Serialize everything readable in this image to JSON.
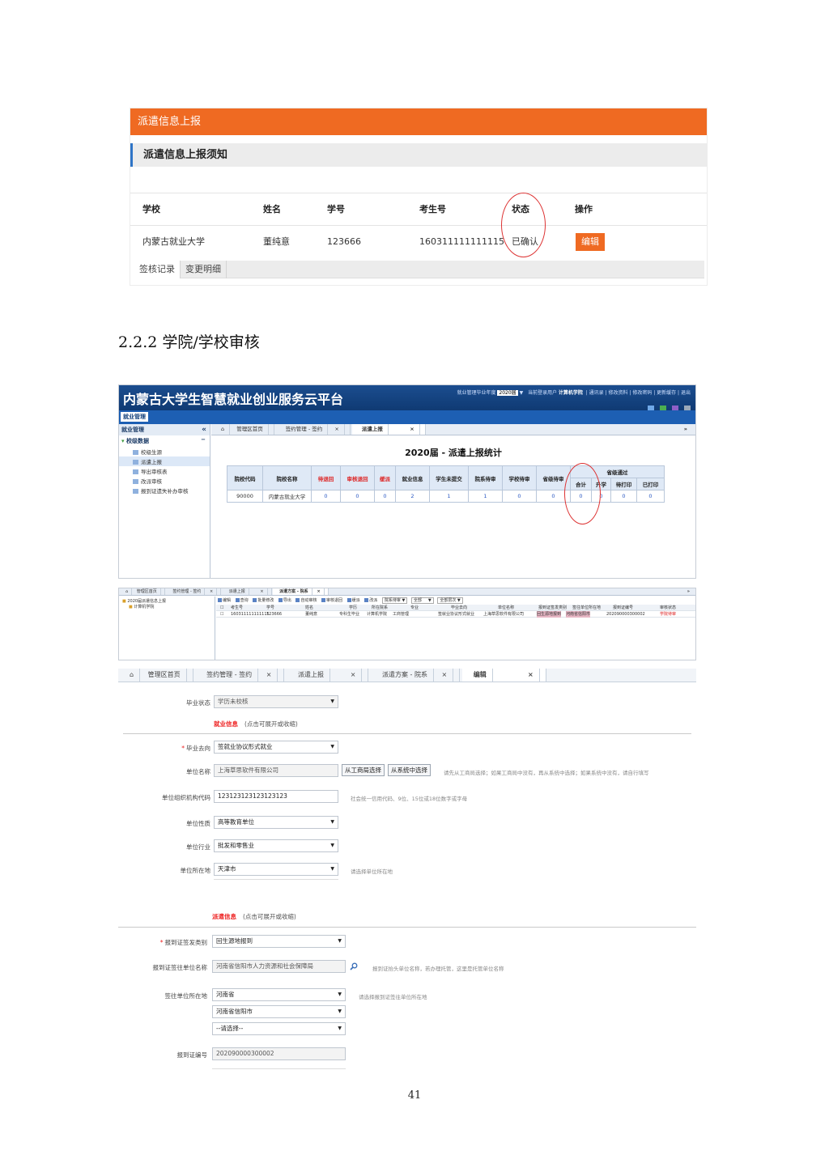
{
  "panel1": {
    "header_title": "派遣信息上报",
    "notice_title": "派遣信息上报须知",
    "columns": [
      "学校",
      "姓名",
      "学号",
      "考生号",
      "状态",
      "操作"
    ],
    "row": {
      "school": "内蒙古就业大学",
      "name": "董纯意",
      "student_id": "123666",
      "exam_id": "160311111111115",
      "status": "已确认",
      "action": "编辑"
    },
    "tabs": [
      "签核记录",
      "变更明细"
    ],
    "accent": "#ef6a22"
  },
  "section_heading": "2.2.2 学院/学校审核",
  "panel2": {
    "platform_title": "内蒙古大学生智慧就业创业服务云平台",
    "top_info_prefix": "就业管理毕业年度",
    "year": "2020届",
    "top_info_user_label": "当前登录用户",
    "top_info_user": "计算机学院",
    "top_links": "通讯录 | 修改资料 | 修改密码 | 更新缓存 | 退出",
    "menu": "就业管理",
    "sidebar_title": "就业管理",
    "sidebar_group": "校级数据",
    "sidebar_items": [
      "校级生源",
      "派遣上报",
      "导出审核表",
      "改派审核",
      "报到证遗失补办审核"
    ],
    "tabs": [
      "管理区首页",
      "签约管理 - 签约",
      "派遣上报"
    ],
    "stat_title": "2020届 - 派遣上报统计",
    "stat_headers": [
      "院校代码",
      "院校名称",
      "待退回",
      "审核退回",
      "缓派",
      "就业信息",
      "学生未提交",
      "院系待审",
      "学校待审",
      "省级待审"
    ],
    "stat_group": "省级通过",
    "stat_subheaders": [
      "合计",
      "升学",
      "待打印",
      "已打印"
    ],
    "stat_row": [
      "90000",
      "内蒙古就业大学",
      "0",
      "0",
      "0",
      "2",
      "1",
      "1",
      "0",
      "0",
      "0",
      "0",
      "0",
      "0"
    ]
  },
  "panel3": {
    "tabs": [
      "管理区首页",
      "签约管理 - 签约",
      "派遣上报",
      "派遣方案 - 院系"
    ],
    "tree_root": "2020届派遣信息上报",
    "tree_child": "计算机学院",
    "toolbar": [
      "编辑",
      "查询",
      "批量修改",
      "导出",
      "自动审核",
      "审核退回",
      "缓派",
      "改派"
    ],
    "filter1": "院系待审",
    "filter2": "全部",
    "filter3": "全部层次",
    "headers": [
      "考生号",
      "学号",
      "姓名",
      "学历",
      "所在院系",
      "专业",
      "毕业去向",
      "单位名称",
      "报到证签发类别",
      "签往单位所在地",
      "报到证编号",
      "审核状态"
    ],
    "row": [
      "160311111111115",
      "123666",
      "董纯意",
      "专科生毕业",
      "计算机学院",
      "工商管理",
      "签就业协议形式就业",
      "上海草思软件有限公司",
      "回生源地报到",
      "河南省信阳市",
      "202090000300002",
      "学院待审"
    ]
  },
  "panel4": {
    "tabs": [
      "管理区首页",
      "签约管理 - 签约",
      "派遣上报",
      "派遣方案 - 院系",
      "编辑"
    ],
    "graduation_status_label": "毕业状态",
    "graduation_status_value": "学历未校核",
    "section1_title": "就业信息",
    "section1_hint": "(点击可展开或收缩)",
    "destination_label": "毕业去向",
    "destination_value": "签就业协议形式就业",
    "unit_name_label": "单位名称",
    "unit_name_value": "上海草思软件有限公司",
    "btn_business": "从工商局选择",
    "btn_system": "从系统中选择",
    "unit_name_hint": "请先从工商局选择；如果工商局中没有，再从系统中选择；如果系统中没有，请自行填写",
    "org_code_label": "单位组织机构代码",
    "org_code_value": "123123123123123123",
    "org_code_hint": "社会统一信用代码、9位、15位或18位数字或字母",
    "unit_nature_label": "单位性质",
    "unit_nature_value": "高等教育单位",
    "industry_label": "单位行业",
    "industry_value": "批发和零售业",
    "location_label": "单位所在地",
    "location_value": "天津市",
    "location_hint": "请选择单位所在地",
    "section2_title": "派遣信息",
    "section2_hint": "(点击可展开或收缩)",
    "cert_type_label": "报到证签发类别",
    "cert_type_value": "回生源地报到",
    "cert_unit_label": "报到证签往单位名称",
    "cert_unit_value": "河南省信阳市人力资源和社会保障局",
    "cert_unit_hint": "报到证抬头单位名称，若办理托管，这里是托管单位名称",
    "cert_location_label": "签往单位所在地",
    "province_value": "河南省",
    "city_value": "河南省信阳市",
    "district_value": "--请选择--",
    "cert_location_hint": "请选择报到证签往单位所在地",
    "cert_no_label": "报到证编号",
    "cert_no_value": "202090000300002"
  },
  "page_number": "41"
}
